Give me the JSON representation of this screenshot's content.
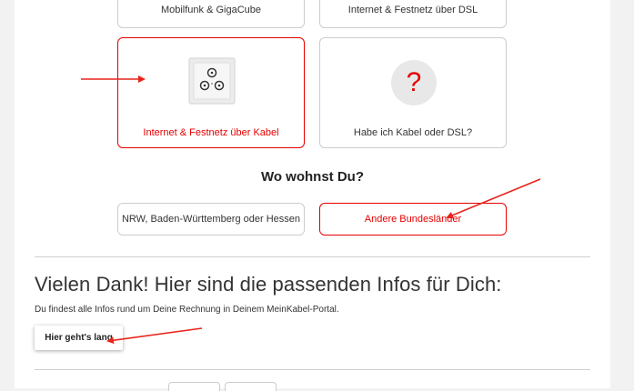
{
  "product_options": [
    {
      "label": "Mobilfunk & GigaCube"
    },
    {
      "label": "Internet & Festnetz über DSL"
    },
    {
      "label": "Internet & Festnetz über Kabel",
      "icon": "cable-socket-icon",
      "selected": true
    },
    {
      "label": "Habe ich Kabel oder DSL?",
      "icon": "question-icon",
      "icon_glyph": "?"
    }
  ],
  "region": {
    "heading": "Wo wohnst Du?",
    "options": [
      {
        "label": "NRW, Baden-Württemberg oder Hessen"
      },
      {
        "label": "Andere Bundesländer",
        "selected": true
      }
    ]
  },
  "result": {
    "title": "Vielen Dank! Hier sind die passenden Infos für Dich:",
    "description": "Du findest alle Infos rund um Deine Rechnung in Deinem MeinKabel-Portal.",
    "button_label": "Hier geht's lang"
  },
  "colors": {
    "accent": "#e60000",
    "border": "#cccccc",
    "annotation_arrow": "#e8241c"
  }
}
